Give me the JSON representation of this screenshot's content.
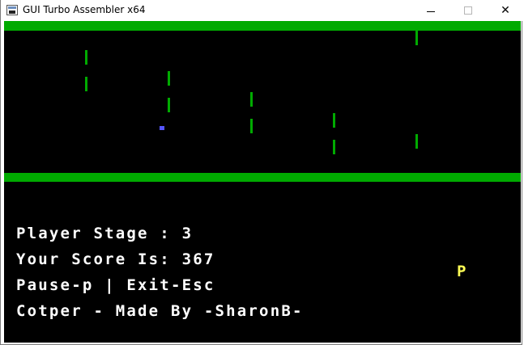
{
  "window": {
    "title": "GUI Turbo Assembler x64",
    "buttons": {
      "minimize": "—",
      "maximize": "☐",
      "close": "✕"
    }
  },
  "colors": {
    "ground": "#00aa00",
    "bird": "#5555ff",
    "pause_indicator": "#ffff55",
    "hud_text": "#ffffff",
    "screen_bg": "#000000"
  },
  "game": {
    "pipe_count": 10,
    "bird_count": 1
  },
  "hud": {
    "stage_line": "Player Stage : 3",
    "score_line": "Your Score Is: 367",
    "controls_line": "Pause-p | Exit-Esc",
    "credit_line": "Cotper - Made By -SharonB-",
    "pause_indicator": "P"
  }
}
